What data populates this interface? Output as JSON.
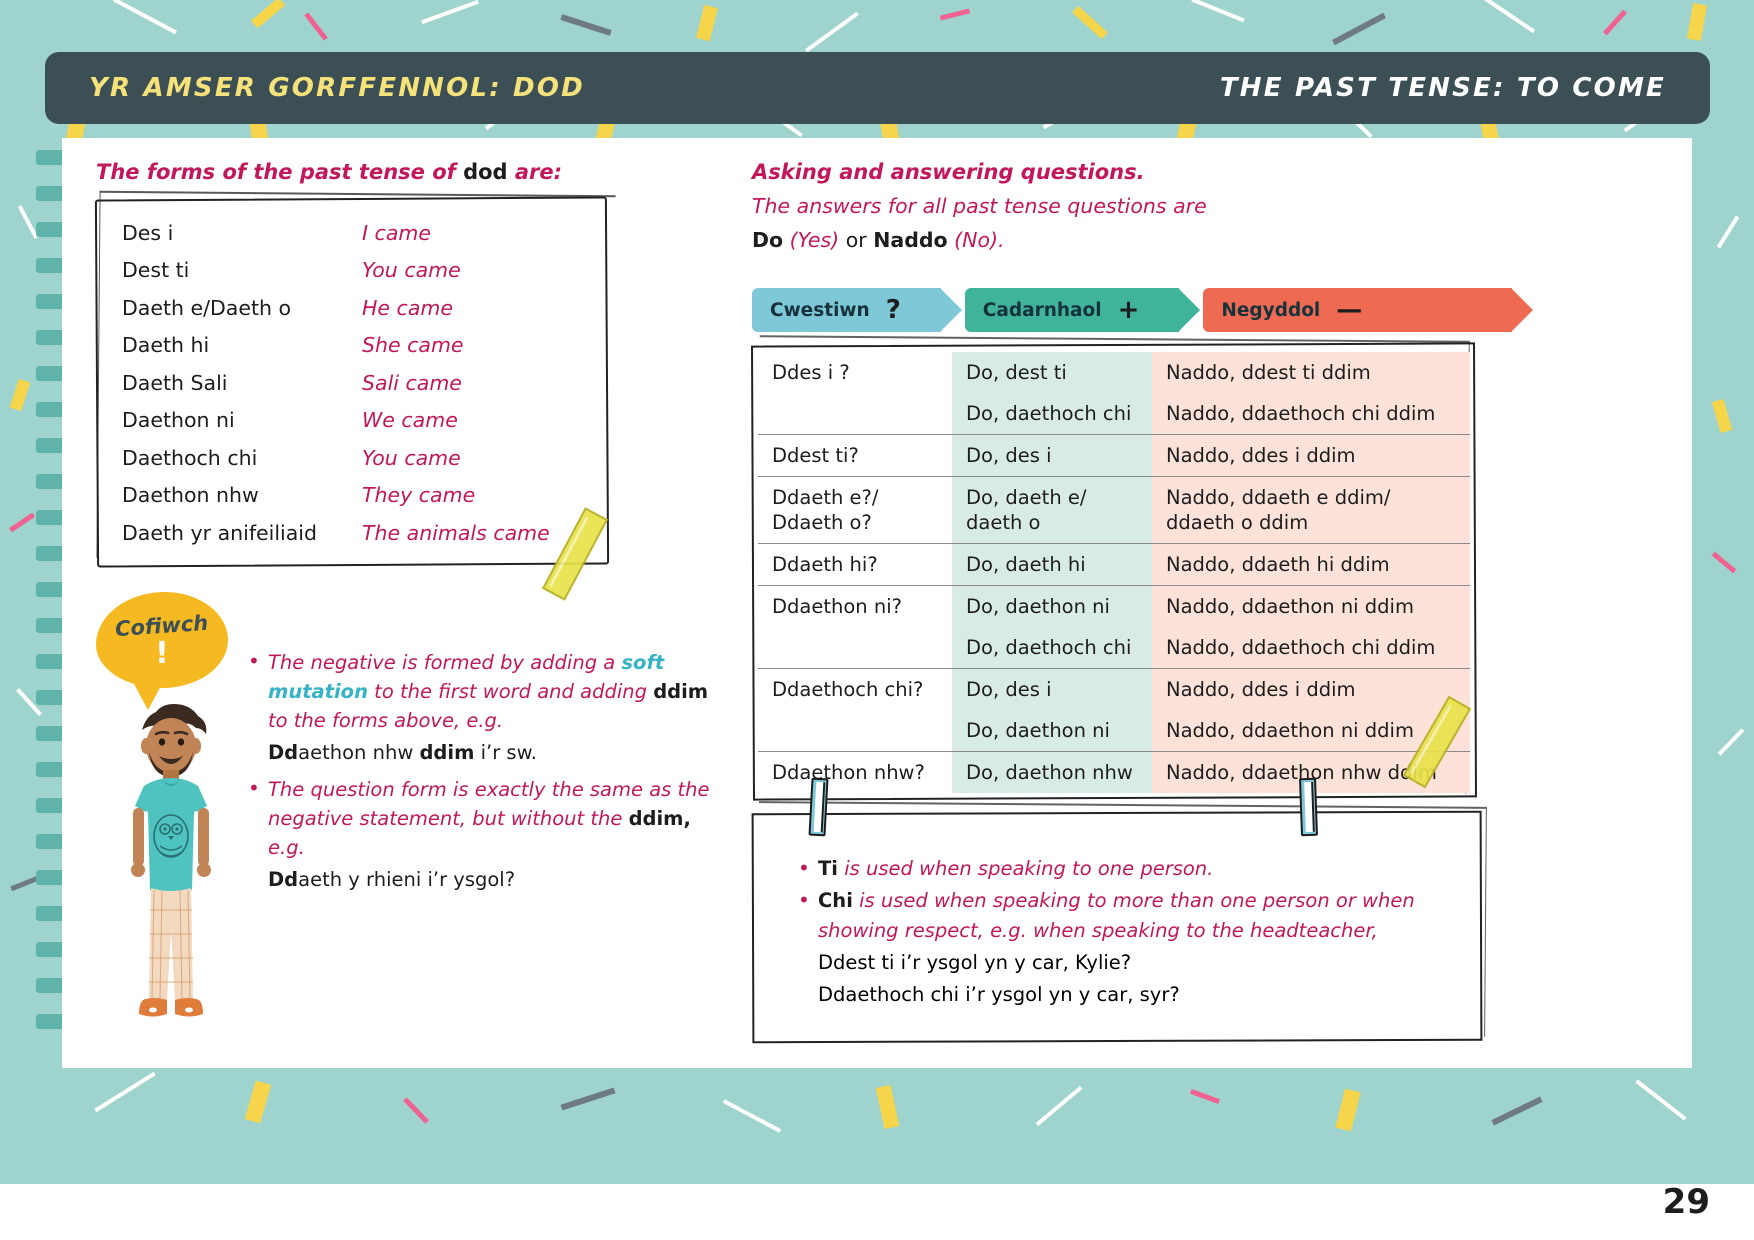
{
  "header": {
    "title_cy": "YR AMSER GORFFENNOL: DOD",
    "title_en": "THE PAST TENSE: TO COME"
  },
  "left": {
    "lead_a": "The forms of the past tense of ",
    "lead_b": "dod",
    "lead_c": " are:",
    "verb_table": {
      "rows": [
        {
          "cy": "Des i",
          "en": "I came"
        },
        {
          "cy": "Dest ti",
          "en": "You came"
        },
        {
          "cy": "Daeth e/Daeth o",
          "en": "He came"
        },
        {
          "cy": "Daeth hi",
          "en": "She came"
        },
        {
          "cy": "Daeth Sali",
          "en": "Sali came"
        },
        {
          "cy": "Daethon ni",
          "en": "We came"
        },
        {
          "cy": "Daethoch chi",
          "en": "You came"
        },
        {
          "cy": "Daethon nhw",
          "en": "They came"
        },
        {
          "cy": "Daeth yr anifeiliaid",
          "en": "The animals came"
        }
      ]
    },
    "remember": {
      "word": "Cofiwch",
      "symbol": "!"
    },
    "bullets": {
      "b1_p1": "The negative is formed by adding a ",
      "b1_soft": "soft mutation",
      "b1_p2": " to the first word and adding ",
      "b1_ddim": "ddim",
      "b1_p3": " to the forms above, e.g.",
      "b1_example_bold": "Dd",
      "b1_example_rest": "aethon nhw ",
      "b1_example_bold2": "ddim",
      "b1_example_rest2": " i’r sw.",
      "b2_p1": "The question form is exactly the same as the negative statement, but without the ",
      "b2_ddim": "ddim,",
      "b2_p2": " e.g.",
      "b2_example_bold": "Dd",
      "b2_example_rest": "aeth y rhieni i’r ysgol?"
    }
  },
  "right": {
    "lead1": "Asking and answering questions.",
    "lead2": "The answers for all past tense questions are",
    "lead3_do": "Do",
    "lead3_yes": " (Yes) ",
    "lead3_or": "or ",
    "lead3_naddo": "Naddo",
    "lead3_no": " (No).",
    "banners": [
      {
        "label": "Cwestiwn",
        "symbol": "?",
        "color": "#7ec8d8"
      },
      {
        "label": "Cadarnhaol",
        "symbol": "+",
        "color": "#3fb49b"
      },
      {
        "label": "Negyddol",
        "symbol": "—",
        "color": "#ef6a53"
      }
    ],
    "qa_rows": [
      {
        "question": "Ddes i ?",
        "affirm": [
          "Do, dest ti",
          "Do, daethoch chi"
        ],
        "negative": [
          "Naddo, ddest ti ddim",
          "Naddo, ddaethoch chi ddim"
        ]
      },
      {
        "question": "Ddest ti?",
        "affirm": [
          "Do, des i"
        ],
        "negative": [
          "Naddo, ddes i ddim"
        ]
      },
      {
        "question": "Ddaeth e?/ Ddaeth o?",
        "affirm": [
          "Do, daeth e/ daeth o"
        ],
        "negative": [
          "Naddo, ddaeth e ddim/ ddaeth o ddim"
        ]
      },
      {
        "question": "Ddaeth hi?",
        "affirm": [
          "Do, daeth hi"
        ],
        "negative": [
          "Naddo, ddaeth hi ddim"
        ]
      },
      {
        "question": "Ddaethon ni?",
        "affirm": [
          "Do, daethon ni",
          "Do, daethoch chi"
        ],
        "negative": [
          "Naddo, ddaethon ni ddim",
          "Naddo, ddaethoch chi ddim"
        ]
      },
      {
        "question": "Ddaethoch chi?",
        "affirm": [
          "Do, des i",
          "Do, daethon ni"
        ],
        "negative": [
          "Naddo, ddes i ddim",
          "Naddo, ddaethon ni ddim"
        ]
      },
      {
        "question": "Ddaethon nhw?",
        "affirm": [
          "Do, daethon nhw"
        ],
        "negative": [
          "Naddo, ddaethon nhw ddim"
        ]
      }
    ],
    "notes": {
      "n1_bold": "Ti",
      "n1_rest": " is used when speaking to one person.",
      "n2_bold": "Chi",
      "n2_rest": " is used when speaking to more than one person or when showing respect, e.g. when speaking to the headteacher,",
      "n2_ex1": "Ddest ti i’r ysgol yn y car, Kylie?",
      "n2_ex2": "Ddaethoch chi i’r ysgol yn y car, syr?"
    }
  },
  "page_number": "29",
  "colors": {
    "header_bg": "#3c4f55",
    "header_cy": "#f6e27a",
    "magenta": "#c2185b",
    "cyan": "#36b3c6",
    "bg_teal": "#9ed4cd",
    "affirm_cell": "#d9ebe6",
    "negative_cell": "#fce2d8",
    "bubble_yellow": "#f5b921"
  }
}
